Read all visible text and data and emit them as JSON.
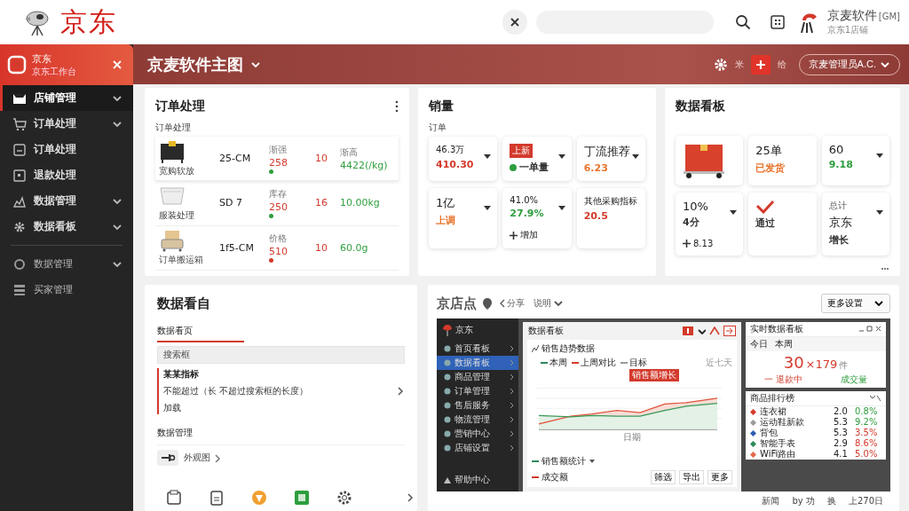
{
  "header": {
    "logo": "京东",
    "user": {
      "name": "京麦软件",
      "tag": "[GM]",
      "sub": "京东1店铺"
    }
  },
  "sidebar": {
    "brand": {
      "name": "京东",
      "sub": "京东工作台"
    },
    "groups": [
      [
        {
          "label": "店铺管理",
          "kind": "group",
          "selected": true
        },
        {
          "label": "订单处理",
          "kind": "group",
          "selected": false
        },
        {
          "label": "订单处理",
          "kind": "link",
          "selected": false
        },
        {
          "label": "退款处理",
          "kind": "link",
          "selected": false
        },
        {
          "label": "数据管理",
          "kind": "group",
          "selected": false
        },
        {
          "label": "数据看板",
          "kind": "group",
          "selected": false
        }
      ],
      [
        {
          "label": "数据管理",
          "kind": "group",
          "selected": false
        },
        {
          "label": "买家管理",
          "kind": "link",
          "selected": false
        }
      ]
    ]
  },
  "banner": {
    "title": "京麦软件主图",
    "settings_label": "米",
    "add_label": "给",
    "account": "京麦管理员A.C."
  },
  "orders": {
    "title": "订单处理",
    "subtitle": "订单处理",
    "rows": [
      {
        "item": "宽购软放",
        "code": "25-CM",
        "price_label": "渐强",
        "price": "258",
        "color": "#2e9e3e",
        "qty": "10",
        "amount_label": "渐高",
        "amount": "4422(/kg)",
        "selected": true
      },
      {
        "item": "服装处理",
        "code": "SD 7",
        "price_label": "库存",
        "price": "250",
        "color": "#2e9e3e",
        "qty": "16",
        "amount": "10.00kg",
        "selected": false
      },
      {
        "item": "订单搬运箱",
        "code": "1f5-CM",
        "price_label": "价格",
        "price": "510",
        "color": "#d33a2c",
        "qty": "10",
        "amount": "60.0g",
        "selected": false
      }
    ]
  },
  "sales": {
    "title": "销量",
    "subtitle": "订单",
    "tiles": [
      {
        "kind": "metric",
        "value": "46.3万",
        "sub": "410.30",
        "color": "#d33a2c",
        "dropdown": true
      },
      {
        "kind": "flag",
        "flag": "上新",
        "sub": "一单量",
        "color": "#333333",
        "dropdown": true
      },
      {
        "kind": "metric",
        "value": "丁流推荐",
        "sub": "6.23",
        "color": "#e8742c",
        "dropdown": true
      },
      {
        "kind": "metric",
        "value": "1亿",
        "sub": "上调",
        "color": "#e8742c",
        "dropdown": true
      },
      {
        "kind": "metric",
        "value": "41.0%",
        "sub": "27.9%",
        "color": "#2e9e3e",
        "note": "增加",
        "dropdown": true
      },
      {
        "kind": "metric",
        "value": "其他采购指标",
        "sub": "20.5",
        "color": "#d33a2c",
        "dropdown": false
      }
    ]
  },
  "board": {
    "title": "数据看板",
    "tiles": [
      {
        "kind": "box",
        "dropdown": false
      },
      {
        "kind": "metric",
        "value": "25单",
        "sub": "已发货",
        "color": "#e8742c",
        "dropdown": false
      },
      {
        "kind": "metric",
        "value": "60",
        "sub": "9.18",
        "color": "#2e9e3e",
        "dropdown": true
      },
      {
        "kind": "metric",
        "value": "10%",
        "sub": "4分",
        "color": "#333333",
        "note": "8.13",
        "dropdown": true
      },
      {
        "kind": "check",
        "sub": "通过",
        "color": "#333333",
        "dropdown": false
      },
      {
        "kind": "metric",
        "label": "总计",
        "value": "京东",
        "sub": "增长",
        "color": "#333333",
        "dropdown": true
      }
    ]
  },
  "overview": {
    "title": "数据看自",
    "tab": "数据看页",
    "search": {
      "value": "搜索框"
    },
    "item": {
      "title": "某某指标",
      "text": "不能超过（长 不超过搜索框的长度）",
      "note": "加载"
    },
    "section": "数据管理",
    "link": "外观图"
  },
  "store": {
    "title": "京店点",
    "share": "分享",
    "menu": "说明",
    "select": "更多设置",
    "app": {
      "brand": "京东",
      "nav": [
        {
          "label": "首页看板",
          "selected": false
        },
        {
          "label": "数据看板",
          "selected": true
        },
        {
          "label": "商品管理",
          "selected": false
        },
        {
          "label": "订单管理",
          "selected": false
        },
        {
          "label": "售后服务",
          "selected": false
        },
        {
          "label": "物流管理",
          "selected": false
        },
        {
          "label": "营销中心",
          "selected": false
        },
        {
          "label": "店铺设置",
          "selected": false
        }
      ],
      "help": "帮助中心",
      "panel": "数据看板",
      "chart_title": "销售趋势数据",
      "legend": [
        "本周",
        "上周对比",
        "目标"
      ],
      "range": "近七天",
      "tooltip": "销售额增长",
      "xlabel": "日期",
      "series_select": "销售额统计",
      "series_line": "成交额",
      "buttons": [
        "筛选",
        "导出",
        "更多"
      ],
      "live": {
        "title": "实时数据看板",
        "tabs": [
          "今日",
          "本周"
        ],
        "big": "30",
        "times": "×179",
        "unit": "件",
        "left": "一 退款中",
        "right": "成交量"
      },
      "rank": {
        "title": "商品排行榜",
        "rows": [
          {
            "name": "连衣裙",
            "count": "2.0",
            "change": "0.8%",
            "color": "#d33a2c",
            "rising": true
          },
          {
            "name": "运动鞋新款",
            "count": "5.3",
            "change": "9.2%",
            "color": "#9a9a9a",
            "rising": true
          },
          {
            "name": "背包",
            "count": "5.3",
            "change": "3.5%",
            "color": "#2d5fb0",
            "rising": false
          },
          {
            "name": "智能手表",
            "count": "2.9",
            "change": "8.6%",
            "color": "#2e8a5a",
            "rising": false
          },
          {
            "name": "WiFi路由",
            "count": "4.1",
            "change": "5.0%",
            "color": "#e46a4a",
            "rising": false
          }
        ]
      }
    },
    "footer": [
      "新闻",
      "by 功",
      "换",
      "上270日"
    ]
  }
}
